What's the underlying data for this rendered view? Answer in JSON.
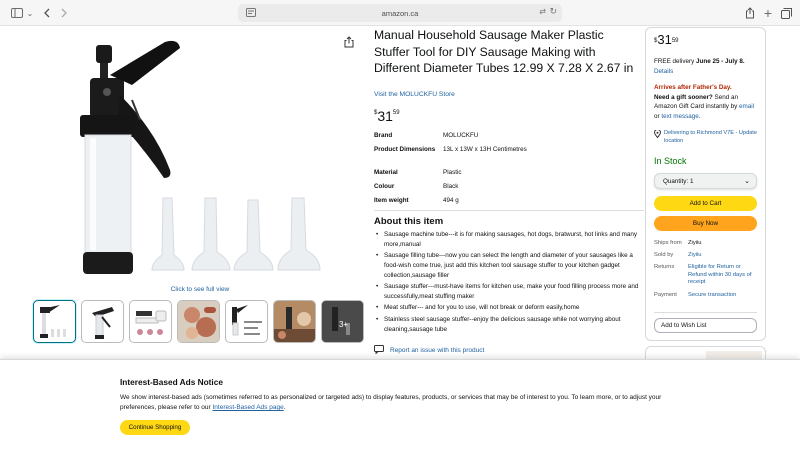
{
  "browser": {
    "url": "amazon.ca"
  },
  "product": {
    "title": "Manual Household Sausage Maker Plastic Stuffer Tool for DIY Sausage Making with Different Diameter Tubes 12.99 X 7.28 X 2.67 in",
    "store_link": "Visit the MOLUCKFU Store",
    "price": {
      "symbol": "$",
      "whole": "31",
      "fraction": "59"
    },
    "full_view_link": "Click to see full view",
    "thumbnails": [
      {
        "kind": "stuffer-tubes",
        "selected": true
      },
      {
        "kind": "stuffer-angle"
      },
      {
        "kind": "stuffer-parts"
      },
      {
        "kind": "sausage-food"
      },
      {
        "kind": "stuffer-infographic"
      },
      {
        "kind": "kitchen-scene"
      },
      {
        "kind": "more",
        "label": "3+"
      }
    ],
    "specs": [
      {
        "key": "Brand",
        "value": "MOLUCKFU"
      },
      {
        "key": "Product Dimensions",
        "value": "13L x 13W x 13H Centimetres"
      },
      {
        "key": "Material",
        "value": "Plastic"
      },
      {
        "key": "Colour",
        "value": "Black"
      },
      {
        "key": "Item weight",
        "value": "494 g"
      }
    ],
    "about_title": "About this item",
    "about_items": [
      "Sausage machine tube---it is for making sausages, hot dogs, bratwurst, hot links and many more,manual",
      "Sausage filling tube---now you can select the length and diameter of your sausages like a food-wish come true, just add this kitchen tool sausage stuffer to your kitchen gadget collection,sausage filler",
      "Sausage stuffer---must-have items for kitchen use, make your food filling process more and successfully,meat stuffing maker",
      "Meat stuffer--- and for you to use, will not break or deform easily,home",
      "Stainless steel sausage stuffer--enjoy the delicious sausage while not worrying about cleaning,sausage tube"
    ],
    "report_link": "Report an issue with this product"
  },
  "buybox": {
    "price": {
      "symbol": "$",
      "whole": "31",
      "fraction": "59"
    },
    "delivery_prefix": "FREE delivery ",
    "delivery_dates": "June 25 - July 8.",
    "details_link": "Details",
    "arrives_notice": "Arrives after Father's Day.",
    "gift_bold": "Need a gift sooner?",
    "gift_text": " Send an Amazon Gift Card instantly by ",
    "gift_email": "email",
    "gift_or": " or ",
    "gift_text_msg": "text message",
    "gift_end": ".",
    "location_link": "Delivering to Richmond V7E - Update location",
    "stock": "In Stock",
    "quantity_label": "Quantity: 1",
    "add_to_cart": "Add to Cart",
    "buy_now": "Buy Now",
    "ships_from_label": "Ships from",
    "ships_from": "Ziyiiu",
    "sold_by_label": "Sold by",
    "sold_by": "Ziyiiu",
    "returns_label": "Returns",
    "returns": "Eligible for Return or Refund within 30 days of receipt",
    "payment_label": "Payment",
    "payment": "Secure transaction",
    "wishlist": "Add to Wish List"
  },
  "notice": {
    "title": "Interest-Based Ads Notice",
    "body": "We show interest-based ads (sometimes referred to as personalized or targeted ads) to display features, products, or services that may be of interest to you. To learn more, or to adjust your preferences, please refer to our ",
    "link": "Interest-Based Ads page",
    "body_end": ".",
    "button": "Continue Shopping"
  },
  "colors": {
    "link": "#2162a1",
    "add_to_cart": "#ffd814",
    "buy_now": "#ffa41c",
    "in_stock": "#007600",
    "arrives": "#b12704"
  }
}
